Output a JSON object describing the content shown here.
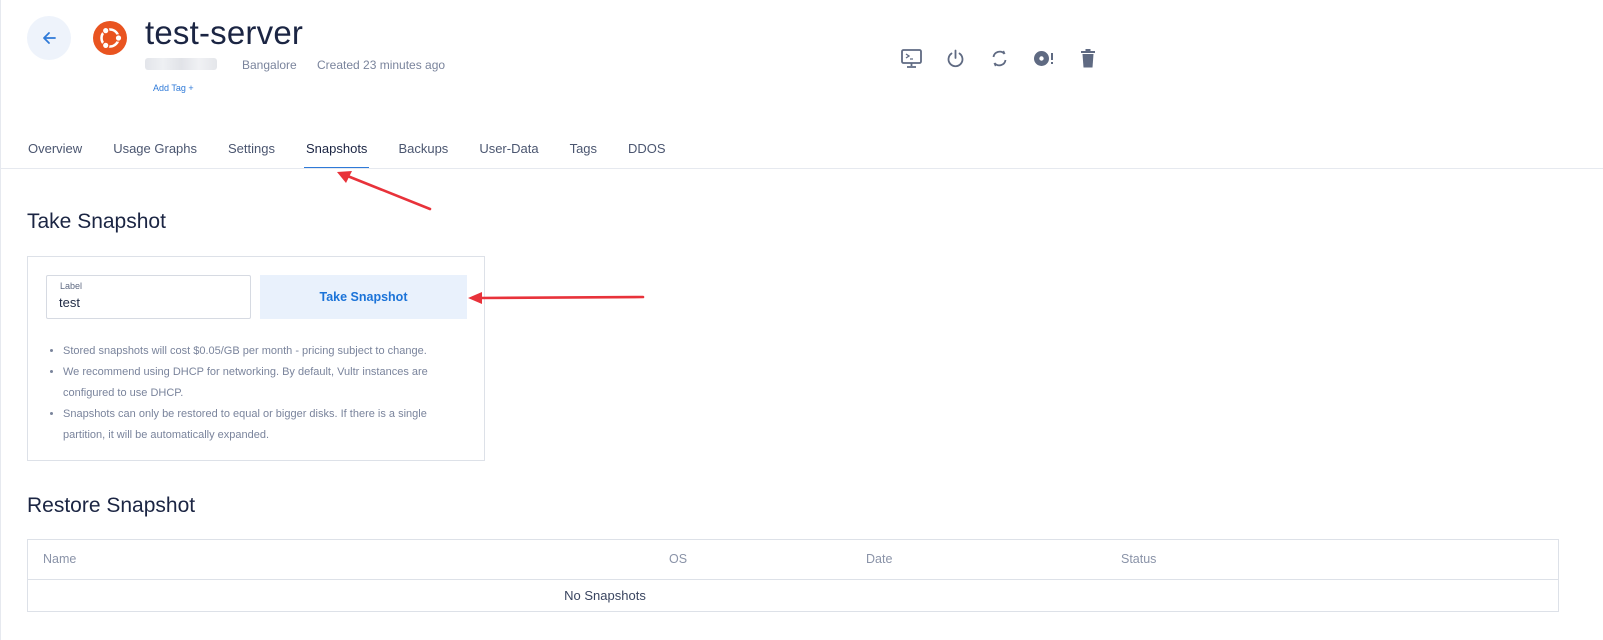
{
  "header": {
    "server_name": "test-server",
    "location": "Bangalore",
    "created": "Created 23 minutes ago",
    "add_tag": "Add Tag +",
    "os_logo": "ubuntu-logo",
    "actions": [
      "console-icon",
      "power-icon",
      "restart-icon",
      "reinstall-icon",
      "delete-icon"
    ]
  },
  "tabs": [
    {
      "label": "Overview"
    },
    {
      "label": "Usage Graphs"
    },
    {
      "label": "Settings"
    },
    {
      "label": "Snapshots",
      "active": true
    },
    {
      "label": "Backups"
    },
    {
      "label": "User-Data"
    },
    {
      "label": "Tags"
    },
    {
      "label": "DDOS"
    }
  ],
  "take_snapshot": {
    "title": "Take Snapshot",
    "label_caption": "Label",
    "label_value": "test",
    "button": "Take Snapshot",
    "notes": [
      "Stored snapshots will cost $0.05/GB per month - pricing subject to change.",
      "We recommend using DHCP for networking. By default, Vultr instances are configured to use DHCP.",
      "Snapshots can only be restored to equal or bigger disks. If there is a single partition, it will be automatically expanded."
    ]
  },
  "restore_snapshot": {
    "title": "Restore Snapshot",
    "columns": [
      "Name",
      "OS",
      "Date",
      "Status"
    ],
    "empty_text": "No Snapshots"
  },
  "colors": {
    "accent": "#2f7ad8",
    "annotation_arrow": "#e8323a",
    "ubuntu_orange": "#e95420"
  }
}
